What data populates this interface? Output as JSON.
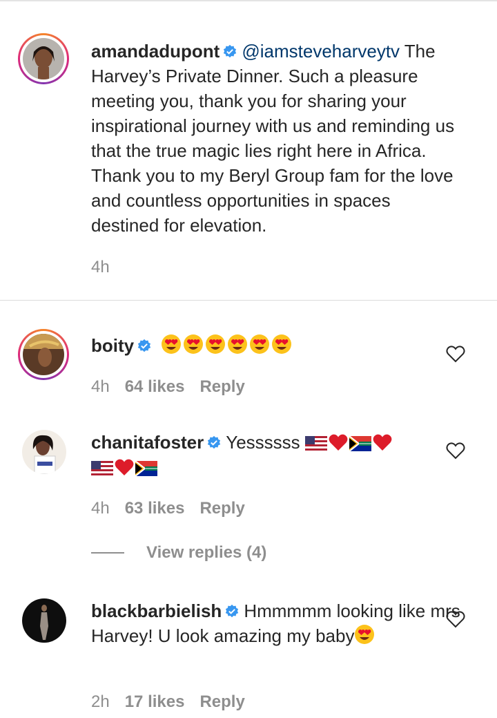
{
  "caption": {
    "username": "amandadupont",
    "mention": "@iamsteveharveytv",
    "text": " The Harvey’s Private Dinner. Such a pleasure meeting you, thank you for sharing your inspirational journey with us and reminding us that the true magic lies right here in Africa. Thank you to my Beryl Group fam for the love and countless opportunities in spaces destined for elevation.",
    "time": "4h"
  },
  "comments": [
    {
      "username": "boity",
      "text_before": "",
      "emojis": [
        "heart-eyes-emoji",
        "heart-eyes-emoji",
        "heart-eyes-emoji",
        "heart-eyes-emoji",
        "heart-eyes-emoji",
        "heart-eyes-emoji"
      ],
      "time": "4h",
      "likes": "64 likes",
      "reply": "Reply"
    },
    {
      "username": "chanitafoster",
      "text_before": "Yessssss",
      "emojis": [
        "us-flag-emoji",
        "red-heart-emoji",
        "south-africa-flag-emoji",
        "red-heart-emoji",
        "us-flag-emoji",
        "red-heart-emoji",
        "south-africa-flag-emoji"
      ],
      "time": "4h",
      "likes": "63 likes",
      "reply": "Reply"
    },
    {
      "username": "blackbarbielish",
      "text_before": "Hmmmmm looking like mrs Harvey! U look amazing my baby",
      "emojis": [
        "heart-eyes-emoji"
      ],
      "time": "2h",
      "likes": "17 likes",
      "reply": "Reply"
    }
  ],
  "view_replies": "View replies (4)",
  "colors": {
    "text": "#262626",
    "muted": "#8e8e8e",
    "mention": "#00376b",
    "verified": "#3897f0"
  }
}
